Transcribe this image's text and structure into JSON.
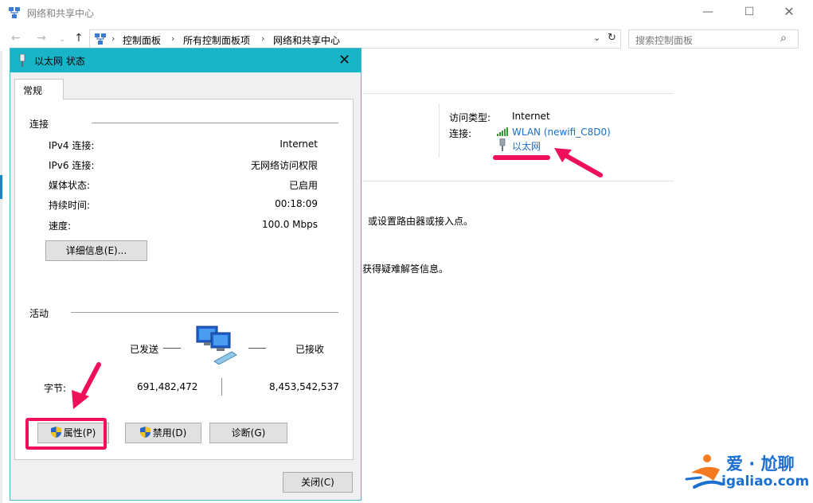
{
  "window": {
    "title": "网络和共享中心",
    "min_glyph": "—",
    "max_glyph": "☐",
    "close_glyph": "✕"
  },
  "nav": {
    "back_glyph": "←",
    "forward_glyph": "→",
    "dropdown_glyph": "⌄",
    "up_glyph": "↑",
    "breadcrumbs": [
      "控制面板",
      "所有控制面板项",
      "网络和共享中心"
    ],
    "sep_glyph": "›",
    "address_dropdown_glyph": "⌄",
    "refresh_glyph": "↻",
    "search_placeholder": "搜索控制面板",
    "search_glyph": "⌕"
  },
  "background": {
    "access_type_label": "访问类型:",
    "access_type_value": "Internet",
    "connections_label": "连接:",
    "wlan_link": "WLAN (newifi_C8D0)",
    "ethernet_link": "以太网",
    "text1": "或设置路由器或接入点。",
    "text2": "获得疑难解答信息。"
  },
  "dialog": {
    "title": "以太网 状态",
    "close_glyph": "✕",
    "tab_general": "常规",
    "connection_group": "连接",
    "rows": [
      {
        "label": "IPv4 连接:",
        "value": "Internet"
      },
      {
        "label": "IPv6 连接:",
        "value": "无网络访问权限"
      },
      {
        "label": "媒体状态:",
        "value": "已启用"
      },
      {
        "label": "持续时间:",
        "value": "00:18:09"
      },
      {
        "label": "速度:",
        "value": "100.0 Mbps"
      }
    ],
    "details_button": "详细信息(E)...",
    "activity_group": "活动",
    "sent_label": "已发送",
    "received_label": "已接收",
    "bytes_label": "字节:",
    "bytes_sent": "691,482,472",
    "bytes_received": "8,453,542,537",
    "properties_button": "属性(P)",
    "disable_button": "禁用(D)",
    "diagnose_button": "诊断(G)",
    "close_button": "关闭(C)"
  },
  "colors": {
    "dialog_title_bar": "#19b4c8",
    "annotation_red": "#f0105a",
    "link_blue": "#1a6fc2"
  }
}
